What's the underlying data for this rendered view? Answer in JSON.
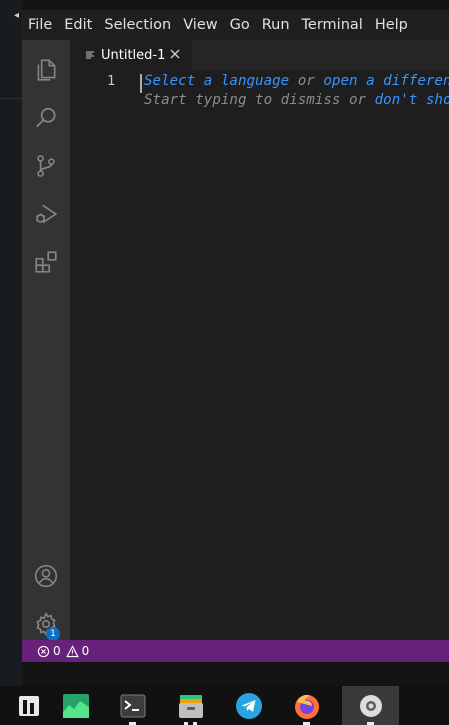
{
  "menubar": {
    "items": [
      "File",
      "Edit",
      "Selection",
      "View",
      "Go",
      "Run",
      "Terminal",
      "Help"
    ]
  },
  "activity_bar": {
    "items": [
      "explorer-icon",
      "search-icon",
      "source-control-icon",
      "run-debug-icon",
      "extensions-icon"
    ],
    "bottom": [
      "account-icon",
      "gear-icon"
    ],
    "settings_badge": "1"
  },
  "tabs": [
    {
      "label": "Untitled-1",
      "icon": "file-lines-icon",
      "active": true
    }
  ],
  "editor": {
    "line_number": "1",
    "hint_line1": {
      "link1": "Select a language",
      "mid": " or ",
      "link2": "open a different"
    },
    "hint_line2": {
      "text": "Start typing to dismiss or ",
      "link": "don't show"
    }
  },
  "statusbar": {
    "errors": "0",
    "warnings": "0",
    "background": "#68217a"
  },
  "taskbar": {
    "apps": [
      "app-grid-icon",
      "system-monitor-icon",
      "terminal-icon",
      "files-icon",
      "telegram-icon",
      "firefox-icon",
      "vscode-icon"
    ]
  }
}
